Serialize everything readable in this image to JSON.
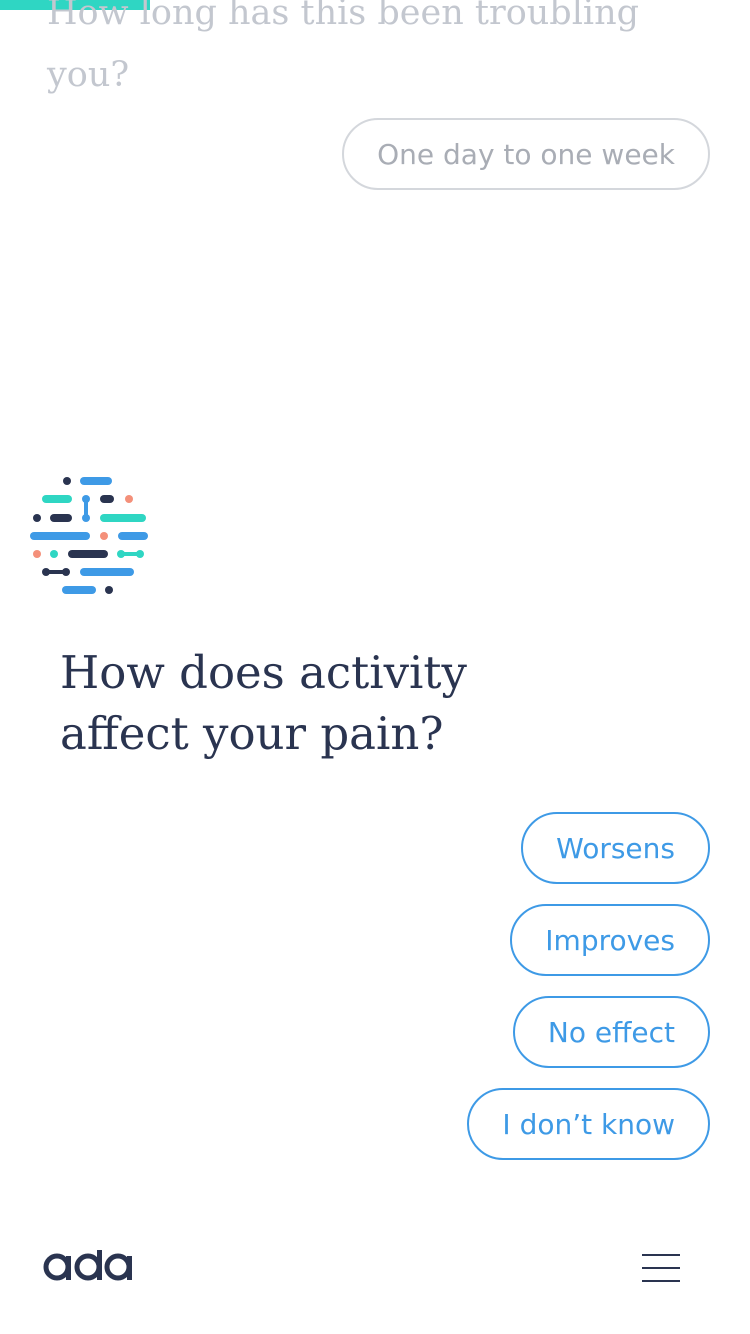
{
  "progress": {
    "fraction": 0.2,
    "color": "#2fd6c3"
  },
  "previous": {
    "question": "How long has this been troubling you?",
    "answer": "One day to one week"
  },
  "current": {
    "question": "How does activity affect your pain?",
    "options": [
      "Worsens",
      "Improves",
      "No effect",
      "I don’t know"
    ]
  },
  "bottom_bar": {
    "logo": "ada",
    "menu_icon": "hamburger-menu-icon"
  },
  "colors": {
    "accent": "#3e9ae6",
    "teal": "#2fd6c3",
    "navy": "#2a3450",
    "coral": "#f4907a",
    "muted_text": "#c3c7cf"
  }
}
